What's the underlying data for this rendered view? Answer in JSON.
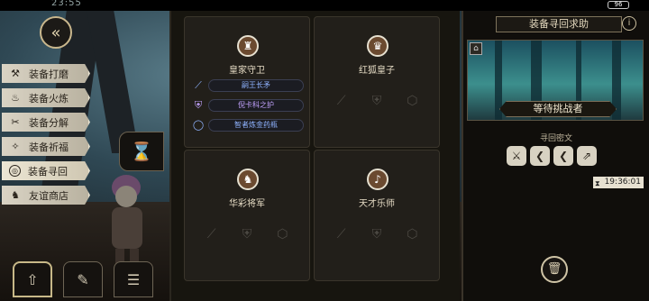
{
  "status_bar": {
    "clock": "23:55",
    "battery": "96"
  },
  "menu": {
    "items": [
      {
        "label": "装备打磨",
        "icon": "hammer-icon",
        "glyph": "⚒"
      },
      {
        "label": "装备火炼",
        "icon": "flame-icon",
        "glyph": "♨"
      },
      {
        "label": "装备分解",
        "icon": "split-icon",
        "glyph": "✂"
      },
      {
        "label": "装备祈福",
        "icon": "blessing-icon",
        "glyph": "✧"
      },
      {
        "label": "装备寻回",
        "icon": "recover-icon",
        "glyph": "◎",
        "active": true
      },
      {
        "label": "友谊商店",
        "icon": "fox-shop-icon",
        "glyph": "♞"
      }
    ]
  },
  "heroes": [
    {
      "name": "皇家守卫",
      "avatar_glyph": "♜",
      "equipment": [
        {
          "name": "嗣王长矛",
          "icon": "spear-icon",
          "glyph": "⟋",
          "color": "#8fb3ff"
        },
        {
          "name": "倪卡科之护",
          "icon": "armor-icon",
          "glyph": "⛨",
          "color": "#c3a3ff"
        },
        {
          "name": "智者炼金药瓶",
          "icon": "ring-icon",
          "glyph": "◯",
          "color": "#8fb3ff"
        }
      ]
    },
    {
      "name": "红狐皇子",
      "avatar_glyph": "♛",
      "equipment": []
    },
    {
      "name": "华彩将军",
      "avatar_glyph": "♞",
      "equipment": []
    },
    {
      "name": "天才乐师",
      "avatar_glyph": "♪",
      "equipment": []
    }
  ],
  "recover_panel": {
    "title": "装备寻回求助",
    "status": "等待挑战者",
    "rune_label": "寻回密文",
    "runes": [
      "⚔",
      "❮",
      "❮",
      "⇗"
    ],
    "timer": "19:36:01"
  },
  "colors": {
    "accent": "#c9b78d",
    "panel": "#221f1a",
    "rare": "#8fb3ff",
    "epic": "#c3a3ff"
  }
}
